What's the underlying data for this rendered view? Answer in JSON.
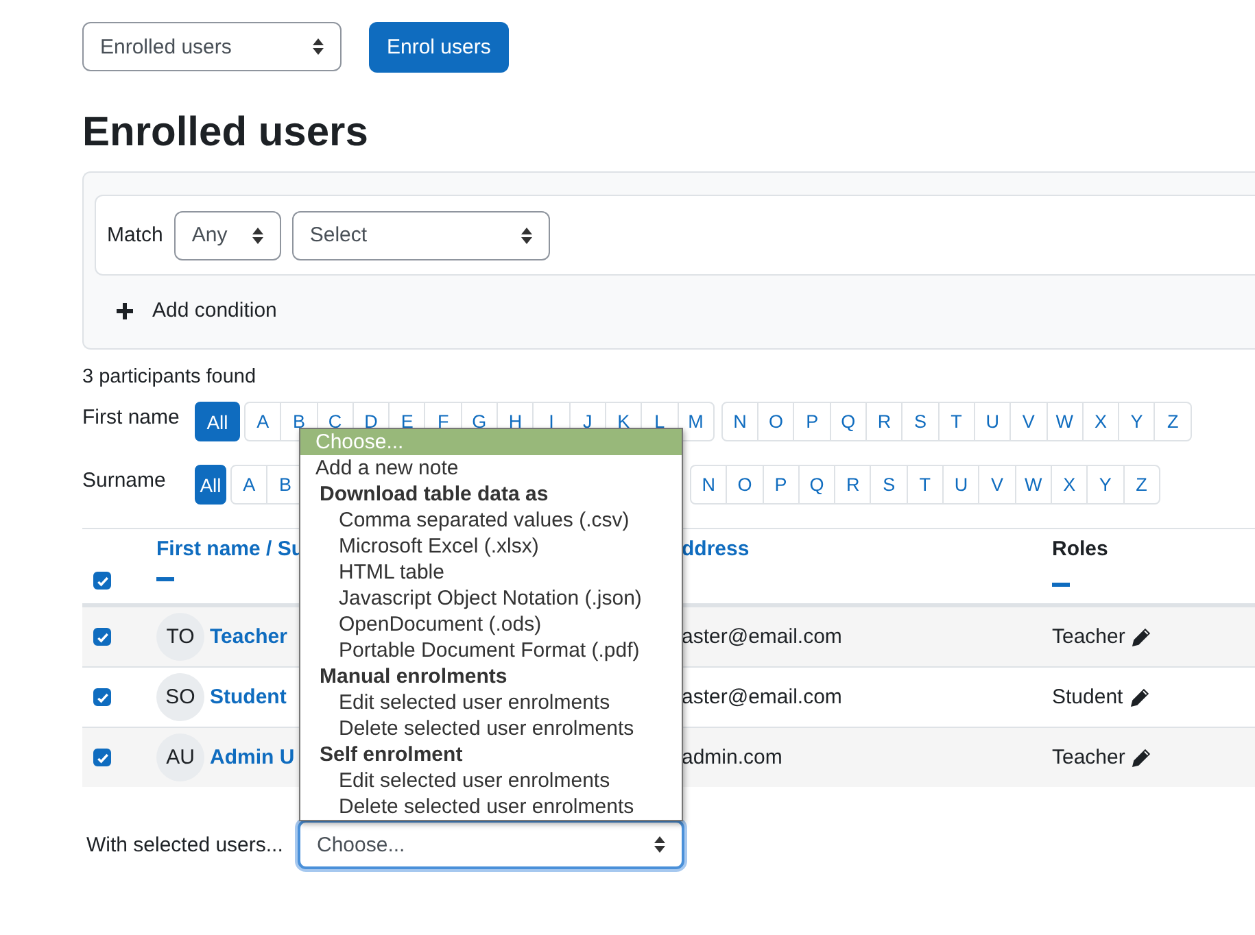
{
  "enrolment_select": {
    "value": "Enrolled users"
  },
  "enrol_button": "Enrol users",
  "heading": "Enrolled users",
  "filter": {
    "match_label": "Match",
    "match_value": "Any",
    "condition_value": "Select",
    "add_condition": "Add condition"
  },
  "participants_found": "3 participants found",
  "initials_bars": [
    {
      "label": "First name",
      "all": {
        "text": "All",
        "selected": true
      },
      "groups": [
        [
          "A",
          "B",
          "C",
          "D",
          "E",
          "F",
          "G",
          "H",
          "I",
          "J",
          "K",
          "L",
          "M"
        ],
        [
          "N",
          "O",
          "P",
          "Q",
          "R",
          "S",
          "T",
          "U",
          "V",
          "W",
          "X",
          "Y",
          "Z"
        ]
      ]
    },
    {
      "label": "Surname",
      "all": {
        "text": "All",
        "selected": true
      },
      "groups": [
        [
          "A",
          "B"
        ],
        [
          "N",
          "O",
          "P",
          "Q",
          "R",
          "S",
          "T",
          "U",
          "V",
          "W",
          "X",
          "Y",
          "Z"
        ]
      ]
    }
  ],
  "table": {
    "select_all_checked": true,
    "columns": [
      {
        "label": "First name / Su",
        "sortable": true
      },
      {
        "label": "ddress",
        "sortable": true
      },
      {
        "label": "Roles",
        "sortable": false
      }
    ],
    "rows": [
      {
        "checked": true,
        "initials": "TO",
        "name": "Teacher",
        "email": "aster@email.com",
        "role": "Teacher"
      },
      {
        "checked": true,
        "initials": "SO",
        "name": "Student",
        "email": "aster@email.com",
        "role": "Student"
      },
      {
        "checked": true,
        "initials": "AU",
        "name": "Admin U",
        "email": "admin.com",
        "role": "Teacher"
      }
    ]
  },
  "bulk_action": {
    "label": "With selected users...",
    "value": "Choose..."
  },
  "dropdown": {
    "options": [
      {
        "kind": "option",
        "text": "Choose...",
        "selected": true
      },
      {
        "kind": "option",
        "text": "Add a new note",
        "selected": false
      },
      {
        "kind": "group",
        "text": "Download table data as"
      },
      {
        "kind": "suboption",
        "text": "Comma separated values (.csv)",
        "selected": false
      },
      {
        "kind": "suboption",
        "text": "Microsoft Excel (.xlsx)",
        "selected": false
      },
      {
        "kind": "suboption",
        "text": "HTML table",
        "selected": false
      },
      {
        "kind": "suboption",
        "text": "Javascript Object Notation (.json)",
        "selected": false
      },
      {
        "kind": "suboption",
        "text": "OpenDocument (.ods)",
        "selected": false
      },
      {
        "kind": "suboption",
        "text": "Portable Document Format (.pdf)",
        "selected": false
      },
      {
        "kind": "group",
        "text": "Manual enrolments"
      },
      {
        "kind": "suboption",
        "text": "Edit selected user enrolments",
        "selected": false
      },
      {
        "kind": "suboption",
        "text": "Delete selected user enrolments",
        "selected": false
      },
      {
        "kind": "group",
        "text": "Self enrolment"
      },
      {
        "kind": "suboption",
        "text": "Edit selected user enrolments",
        "selected": false
      },
      {
        "kind": "suboption",
        "text": "Delete selected user enrolments",
        "selected": false
      }
    ]
  }
}
